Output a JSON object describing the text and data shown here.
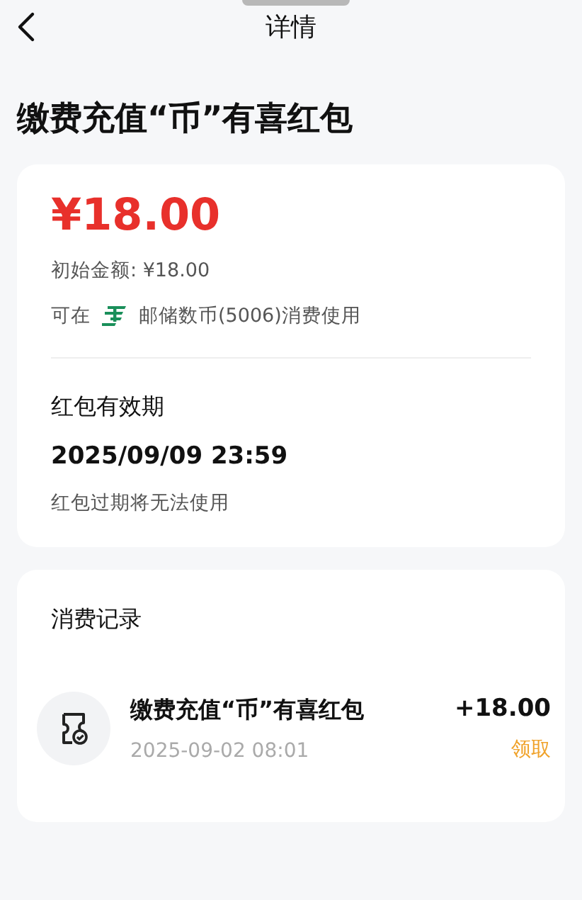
{
  "header": {
    "title": "详情"
  },
  "page_title": "缴费充值“币”有喜红包",
  "summary": {
    "amount": "¥18.00",
    "initial_amount": "初始金额: ¥18.00",
    "usage_prefix": "可在",
    "usage_text": "邮储数币(5006)消费使用"
  },
  "validity": {
    "label": "红包有效期",
    "date": "2025/09/09 23:59",
    "note": "红包过期将无法使用"
  },
  "records": {
    "title": "消费记录",
    "items": [
      {
        "name": "缴费充值“币”有喜红包",
        "time": "2025-09-02 08:01",
        "amount": "+18.00",
        "status": "领取"
      }
    ]
  }
}
